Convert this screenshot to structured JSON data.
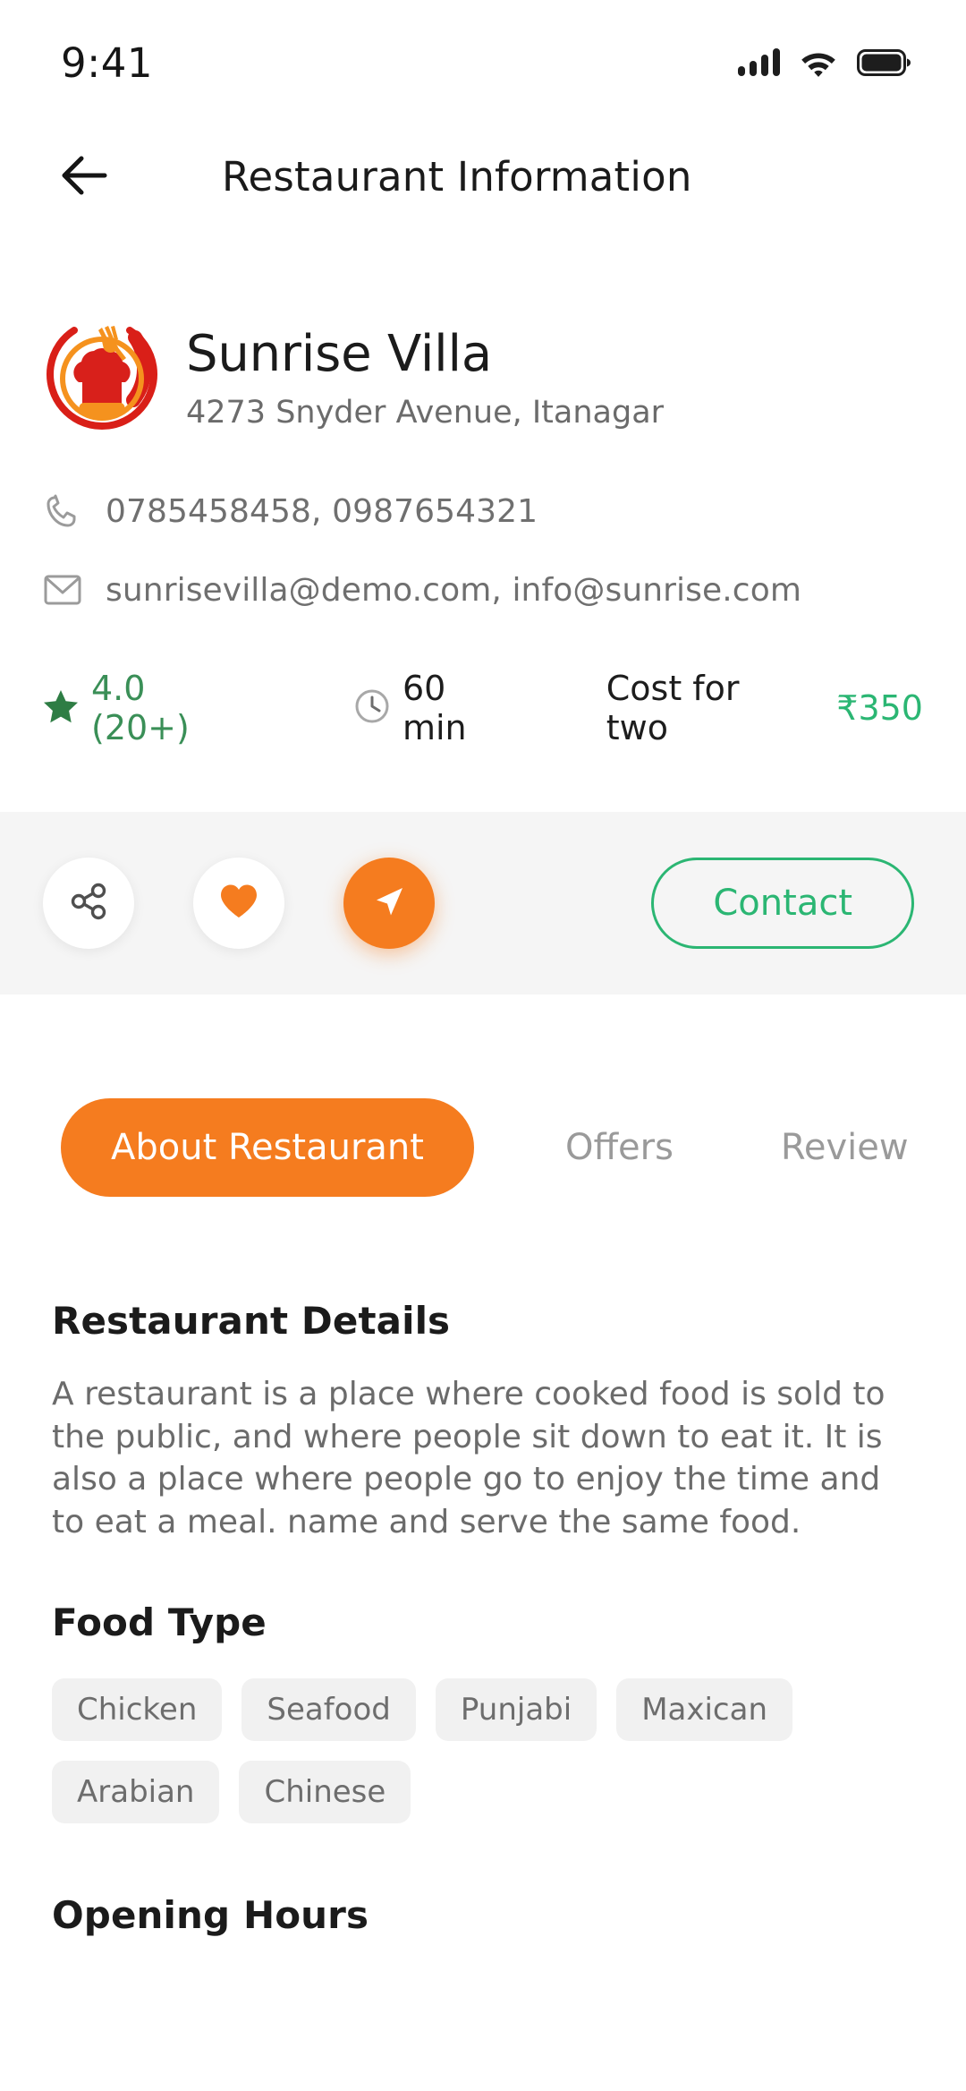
{
  "status_bar": {
    "time": "9:41",
    "signal_icon": "signal-bars-icon",
    "wifi_icon": "wifi-icon",
    "battery_icon": "battery-full-icon"
  },
  "header": {
    "back_icon": "back-arrow-icon",
    "title": "Restaurant Information"
  },
  "restaurant": {
    "logo_icon": "chef-hat-logo",
    "name": "Sunrise Villa",
    "address": "4273 Snyder Avenue, Itanagar",
    "phone_icon": "phone-icon",
    "phone": "0785458458, 0987654321",
    "email_icon": "envelope-icon",
    "email": "sunrisevilla@demo.com, info@sunrise.com"
  },
  "stats": {
    "star_icon": "star-icon",
    "rating": "4.0 (20+)",
    "clock_icon": "clock-icon",
    "delivery_time": "60 min",
    "cost_label": "Cost for two",
    "cost_value": "₹350"
  },
  "actions": {
    "share_icon": "share-icon",
    "favorite_icon": "heart-icon",
    "directions_icon": "navigation-arrow-icon",
    "contact_label": "Contact"
  },
  "tabs": [
    {
      "label": "About Restaurant",
      "active": true
    },
    {
      "label": "Offers",
      "active": false
    },
    {
      "label": "Review",
      "active": false
    }
  ],
  "details": {
    "title": "Restaurant Details",
    "body": "A restaurant is a place where cooked food is sold to the public, and where people sit down to eat it. It is also a place where people go to enjoy the time and to eat a meal.  name and serve the same food."
  },
  "food_type": {
    "title": "Food Type",
    "tags": [
      "Chicken",
      "Seafood",
      "Punjabi",
      "Maxican",
      "Arabian",
      "Chinese"
    ]
  },
  "opening_hours": {
    "title": "Opening Hours"
  },
  "colors": {
    "accent_orange": "#f57c1f",
    "accent_green": "#2bb673",
    "rating_green": "#3a8f57",
    "text_dark": "#1b1b1b",
    "text_muted": "#6b6b6b",
    "strip_bg": "#f5f5f5",
    "tag_bg": "#f1f1f1"
  }
}
